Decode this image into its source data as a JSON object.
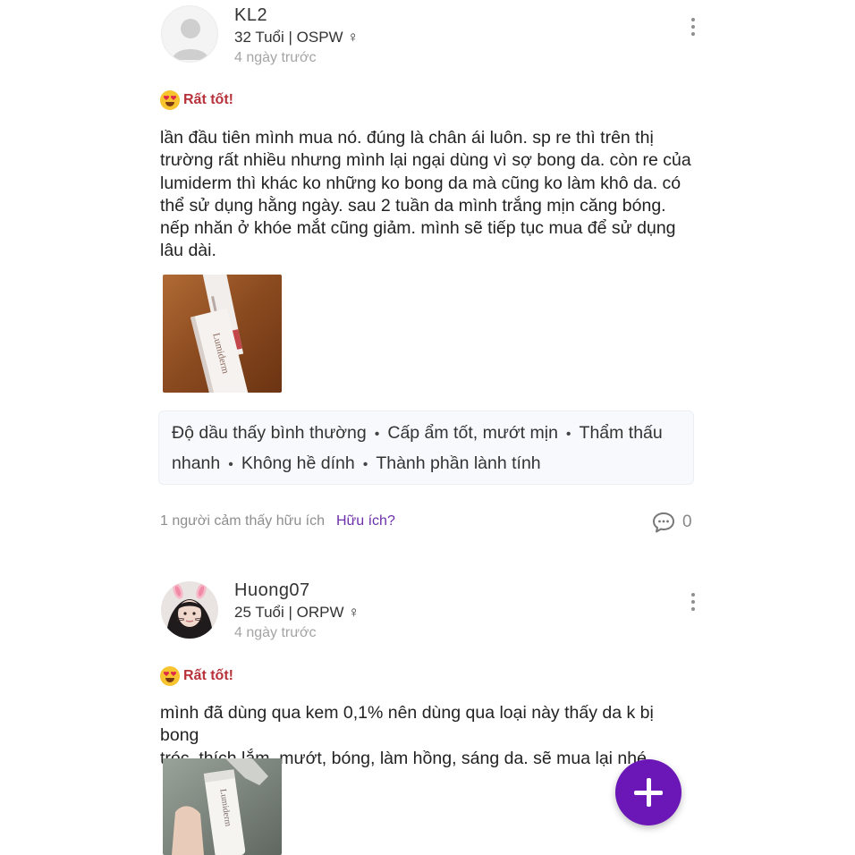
{
  "reviews": [
    {
      "user": {
        "name": "KL2",
        "meta": "32 Tuổi | OSPW ♀",
        "date": "4 ngày trước",
        "avatar_icon": "default-user-icon"
      },
      "rating_label": "Rất tốt!",
      "body": "lần đầu tiên mình mua nó. đúng là chân ái luôn. sp re thì trên thị trường rất nhiều nhưng mình lại ngại dùng vì sợ bong da. còn re của lumiderm thì khác ko những ko bong da mà cũng ko làm khô da. có thể sử dụng hằng ngày. sau 2 tuần da mình trắng mịn căng bóng. nếp nhăn ở khóe mắt cũng giảm. mình sẽ tiếp tục mua để sử dụng lâu dài.",
      "body_lines": [
        "lần đầu tiên mình mua nó. đúng là chân ái luôn. sp re thì trên thị",
        "trường rất nhiều nhưng mình lại ngại dùng vì sợ bong da. còn re của",
        "lumiderm thì khác ko những ko bong da mà cũng ko làm khô da. có",
        "thể sử dụng hằng ngày. sau 2 tuần da mình trắng mịn căng bóng.",
        "nếp nhăn ở khóe mắt cũng giảm. mình sẽ tiếp tục mua để sử dụng",
        "lâu dài."
      ],
      "photo_text": "Lumiderm",
      "tags_line1": [
        "Độ dầu thấy bình thường",
        "Cấp ẩm tốt, mướt mịn",
        "Thẩm thấu"
      ],
      "tags_line2": [
        "nhanh",
        "Không hề dính",
        "Thành phần lành tính"
      ],
      "helpful_text": "1 người cảm thấy hữu ích",
      "helpful_link": "Hữu ích?",
      "comment_count": "0"
    },
    {
      "user": {
        "name": "Huong07",
        "meta": "25 Tuổi | ORPW ♀",
        "date": "4 ngày trước",
        "avatar_icon": "bunny-ears-avatar"
      },
      "rating_label": "Rất tốt!",
      "body_lines": [
        "mình đã dùng qua kem 0,1% nên dùng qua loại này thấy da k bị bong",
        "tróc, thích lắm, mướt, bóng, làm hồng, sáng da. sẽ mua lại nhé"
      ],
      "photo_text": "Lumiderm"
    }
  ],
  "icons": {
    "more": "more-vertical-icon",
    "comment": "comment-bubble-icon",
    "fab": "plus-icon",
    "emoji": "heart-eyes-emoji-icon"
  },
  "colors": {
    "rating": "#b8323b",
    "helpful_link": "#6a2fa8",
    "fab": "#6b16b6",
    "date": "#a4a4a4"
  }
}
